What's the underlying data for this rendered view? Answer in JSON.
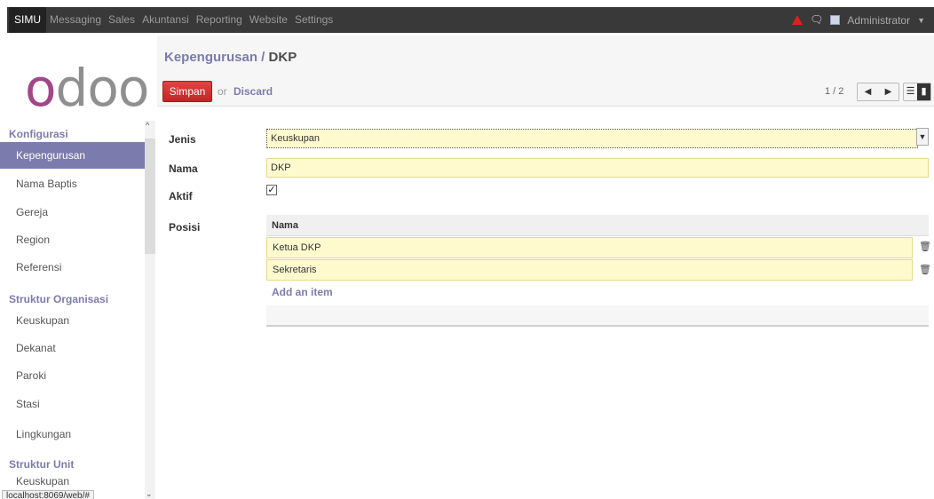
{
  "topbar": {
    "menu": [
      "SIMU",
      "Messaging",
      "Sales",
      "Akuntansi",
      "Reporting",
      "Website",
      "Settings"
    ],
    "user": "Administrator",
    "icons": [
      "alert-icon",
      "chat-icon",
      "avatar",
      "chevron-down-icon"
    ]
  },
  "logo": {
    "text_o1": "o",
    "text_d": "d",
    "text_oo": "oo"
  },
  "sidebar": {
    "sections": [
      {
        "title": "Konfigurasi",
        "items": [
          "Kepengurusan",
          "Nama Baptis",
          "Gereja",
          "Region",
          "Referensi"
        ]
      },
      {
        "title": "Struktur Organisasi",
        "items": [
          "Keuskupan",
          "Dekanat",
          "Paroki",
          "Stasi",
          "Lingkungan"
        ]
      },
      {
        "title": "Struktur Unit",
        "items": [
          "Keuskupan"
        ]
      }
    ],
    "active_item": "Kepengurusan",
    "status_url": "localhost:8069/web/#"
  },
  "header": {
    "breadcrumb_parent": "Kepengurusan",
    "breadcrumb_sep": " / ",
    "breadcrumb_current": "DKP",
    "save_label": "Simpan",
    "or_text": "or",
    "discard_label": "Discard",
    "pager_text": "1 / 2"
  },
  "form": {
    "jenis_label": "Jenis",
    "jenis_value": "Keuskupan",
    "nama_label": "Nama",
    "nama_value": "DKP",
    "aktif_label": "Aktif",
    "aktif_checked": true,
    "posisi_label": "Posisi",
    "posisi_table": {
      "column": "Nama",
      "rows": [
        "Ketua DKP",
        "Sekretaris"
      ],
      "add_label": "Add an item"
    }
  },
  "colors": {
    "brand": "#7c7bad",
    "save": "#c12626",
    "field_bg": "#fffacd",
    "topbar": "#393939"
  }
}
